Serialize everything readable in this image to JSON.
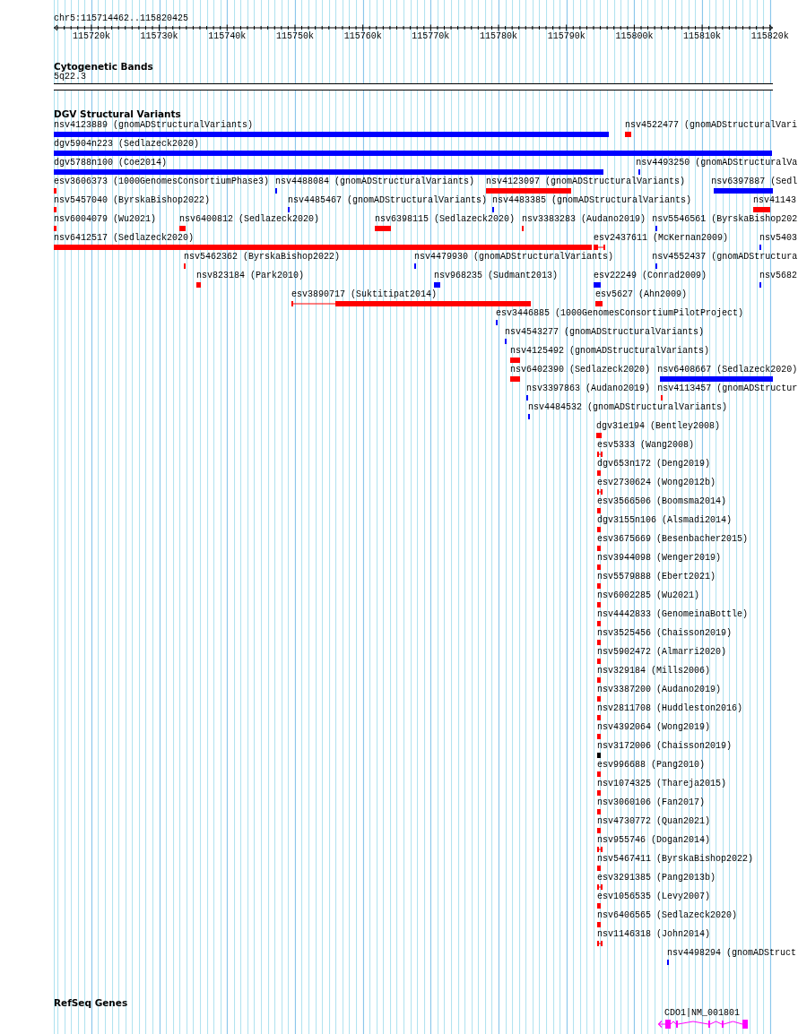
{
  "ruler": {
    "location": "chr5:115714462..115820425",
    "ticks": [
      "115720k",
      "115730k",
      "115740k",
      "115750k",
      "115760k",
      "115770k",
      "115780k",
      "115790k",
      "115800k",
      "115810k",
      "115820k"
    ]
  },
  "tracks": [
    {
      "kind": "cytoband",
      "title": "Cytogenetic Bands",
      "features": [
        {
          "label": "5q22.3"
        }
      ]
    },
    {
      "kind": "variants",
      "title": "DGV Structural Variants",
      "rows": [
        {
          "features": [
            {
              "label": "nsv4123889 (gnomADStructuralVariants)",
              "color": "#0000ff"
            },
            {
              "label": "nsv4522477 (gnomADStructuralVari",
              "color": "#ff0000"
            }
          ]
        },
        {
          "features": [
            {
              "label": "dgv5904n223 (Sedlazeck2020)",
              "color": "#0000ff"
            }
          ]
        },
        {
          "features": [
            {
              "label": "dgv5788n100 (Coe2014)",
              "color": "#0000ff"
            },
            {
              "label": "nsv4493250 (gnomADStructuralVa",
              "color": "#0000ff"
            }
          ]
        },
        {
          "features": [
            {
              "label": "esv3606373 (1000GenomesConsortiumPhase3)",
              "color": "#ff0000"
            },
            {
              "label": "nsv4488084 (gnomADStructuralVariants)",
              "color": "#0000ff"
            },
            {
              "label": "nsv4123097 (gnomADStructuralVariants)",
              "color": "#ff0000"
            },
            {
              "label": "nsv6397887 (Sedl",
              "color": "#0000ff"
            }
          ]
        },
        {
          "features": [
            {
              "label": "nsv5457040 (ByrskaBishop2022)",
              "color": "#ff0000"
            },
            {
              "label": "nsv4485467 (gnomADStructuralVariants)",
              "color": "#0000ff"
            },
            {
              "label": "nsv4483385 (gnomADStructuralVariants)",
              "color": "#0000ff"
            },
            {
              "label": "nsv41143",
              "color": "#ff0000"
            }
          ]
        },
        {
          "features": [
            {
              "label": "nsv6004079 (Wu2021)",
              "color": "#ff0000"
            },
            {
              "label": "nsv6400812 (Sedlazeck2020)",
              "color": "#ff0000"
            },
            {
              "label": "nsv6398115 (Sedlazeck2020)",
              "color": "#ff0000"
            },
            {
              "label": "nsv3383283 (Audano2019)",
              "color": "#ff0000"
            },
            {
              "label": "nsv5546561 (ByrskaBishop202",
              "color": "#0000ff"
            }
          ]
        },
        {
          "features": [
            {
              "label": "nsv6412517 (Sedlazeck2020)",
              "color": "#ff0000"
            },
            {
              "label": "esv2437611 (McKernan2009)",
              "color": "#ff0000"
            },
            {
              "label": "nsv5403",
              "color": "#0000ff"
            }
          ]
        },
        {
          "features": [
            {
              "label": "nsv5462362 (ByrskaBishop2022)",
              "color": "#ff0000"
            },
            {
              "label": "nsv4479930 (gnomADStructuralVariants)",
              "color": "#0000ff"
            },
            {
              "label": "nsv4552437 (gnomADStructura",
              "color": "#0000ff"
            }
          ]
        },
        {
          "features": [
            {
              "label": "nsv823184 (Park2010)",
              "color": "#ff0000"
            },
            {
              "label": "nsv968235 (Sudmant2013)",
              "color": "#0000ff"
            },
            {
              "label": "esv22249 (Conrad2009)",
              "color": "#0000ff"
            },
            {
              "label": "nsv5682",
              "color": "#0000ff"
            }
          ]
        },
        {
          "features": [
            {
              "label": "esv3890717 (Suktitipat2014)",
              "color": "#ff0000"
            },
            {
              "label": "esv5627 (Ahn2009)",
              "color": "#ff0000"
            }
          ]
        },
        {
          "features": [
            {
              "label": "esv3446885 (1000GenomesConsortiumPilotProject)",
              "color": "#0000ff"
            }
          ]
        },
        {
          "features": [
            {
              "label": "nsv4543277 (gnomADStructuralVariants)",
              "color": "#0000ff"
            }
          ]
        },
        {
          "features": [
            {
              "label": "nsv4125492 (gnomADStructuralVariants)",
              "color": "#ff0000"
            }
          ]
        },
        {
          "features": [
            {
              "label": "nsv6402390 (Sedlazeck2020)",
              "color": "#ff0000"
            },
            {
              "label": "nsv6408667 (Sedlazeck2020)",
              "color": "#0000ff"
            }
          ]
        },
        {
          "features": [
            {
              "label": "nsv3397863 (Audano2019)",
              "color": "#0000ff"
            },
            {
              "label": "nsv4113457 (gnomADStructur",
              "color": "#ff0000"
            }
          ]
        },
        {
          "features": [
            {
              "label": "nsv4484532 (gnomADStructuralVariants)",
              "color": "#0000ff"
            }
          ]
        },
        {
          "features": [
            {
              "label": "dgv31e194 (Bentley2008)",
              "color": "#ff0000"
            }
          ]
        },
        {
          "features": [
            {
              "label": "esv5333 (Wang2008)",
              "color": "#ff0000"
            }
          ]
        },
        {
          "features": [
            {
              "label": "dgv653n172 (Deng2019)",
              "color": "#ff0000"
            }
          ]
        },
        {
          "features": [
            {
              "label": "esv2730624 (Wong2012b)",
              "color": "#ff0000"
            }
          ]
        },
        {
          "features": [
            {
              "label": "esv3566506 (Boomsma2014)",
              "color": "#ff0000"
            }
          ]
        },
        {
          "features": [
            {
              "label": "dgv3155n106 (Alsmadi2014)",
              "color": "#ff0000"
            }
          ]
        },
        {
          "features": [
            {
              "label": "esv3675669 (Besenbacher2015)",
              "color": "#ff0000"
            }
          ]
        },
        {
          "features": [
            {
              "label": "nsv3944098 (Wenger2019)",
              "color": "#ff0000"
            }
          ]
        },
        {
          "features": [
            {
              "label": "nsv5579888 (Ebert2021)",
              "color": "#ff0000"
            }
          ]
        },
        {
          "features": [
            {
              "label": "nsv6002285 (Wu2021)",
              "color": "#ff0000"
            }
          ]
        },
        {
          "features": [
            {
              "label": "nsv4442833 (GenomeinaBottle)",
              "color": "#ff0000"
            }
          ]
        },
        {
          "features": [
            {
              "label": "nsv3525456 (Chaisson2019)",
              "color": "#ff0000"
            }
          ]
        },
        {
          "features": [
            {
              "label": "nsv5902472 (Almarri2020)",
              "color": "#ff0000"
            }
          ]
        },
        {
          "features": [
            {
              "label": "nsv329184 (Mills2006)",
              "color": "#ff0000"
            }
          ]
        },
        {
          "features": [
            {
              "label": "nsv3387200 (Audano2019)",
              "color": "#ff0000"
            }
          ]
        },
        {
          "features": [
            {
              "label": "nsv2811708 (Huddleston2016)",
              "color": "#ff0000"
            }
          ]
        },
        {
          "features": [
            {
              "label": "nsv4392064 (Wong2019)",
              "color": "#ff0000"
            }
          ]
        },
        {
          "features": [
            {
              "label": "nsv3172006 (Chaisson2019)",
              "color": "#000000"
            }
          ]
        },
        {
          "features": [
            {
              "label": "esv996688 (Pang2010)",
              "color": "#ff0000"
            }
          ]
        },
        {
          "features": [
            {
              "label": "nsv1074325 (Thareja2015)",
              "color": "#ff0000"
            }
          ]
        },
        {
          "features": [
            {
              "label": "nsv3060106 (Fan2017)",
              "color": "#ff0000"
            }
          ]
        },
        {
          "features": [
            {
              "label": "nsv4730772 (Quan2021)",
              "color": "#ff0000"
            }
          ]
        },
        {
          "features": [
            {
              "label": "nsv955746 (Dogan2014)",
              "color": "#ff0000"
            }
          ]
        },
        {
          "features": [
            {
              "label": "nsv5467411 (ByrskaBishop2022)",
              "color": "#ff0000"
            }
          ]
        },
        {
          "features": [
            {
              "label": "esv3291385 (Pang2013b)",
              "color": "#ff0000"
            }
          ]
        },
        {
          "features": [
            {
              "label": "esv1056535 (Levy2007)",
              "color": "#ff0000"
            }
          ]
        },
        {
          "features": [
            {
              "label": "nsv6406565 (Sedlazeck2020)",
              "color": "#ff0000"
            }
          ]
        },
        {
          "features": [
            {
              "label": "nsv1146318 (John2014)",
              "color": "#ff0000"
            }
          ]
        },
        {
          "features": [
            {
              "label": "nsv4498294 (gnomADStruct",
              "color": "#0000ff"
            }
          ]
        }
      ]
    },
    {
      "kind": "genes",
      "title": "RefSeq Genes",
      "features": [
        {
          "label": "CDO1|NM_001801"
        }
      ]
    }
  ]
}
